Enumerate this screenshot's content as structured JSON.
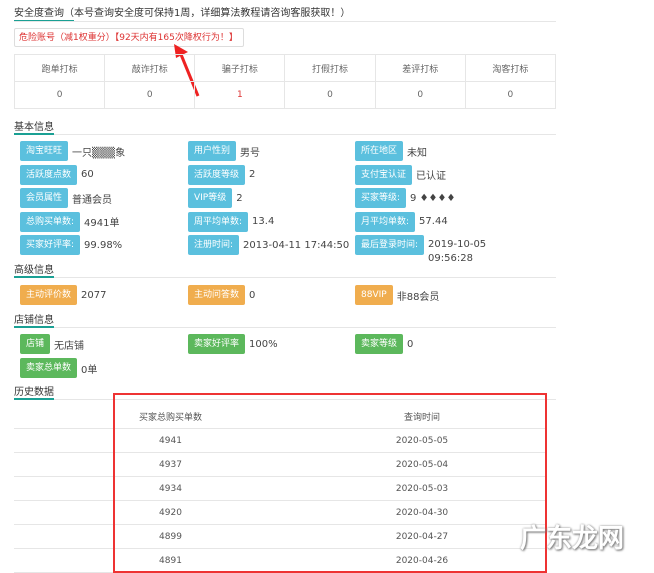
{
  "title": "安全度查询（本号查询安全度可保持1周，详细算法教程请咨询客服获取！）",
  "alert": "危险账号（减1权重分）【92天内有165次降权行为！】",
  "flags": {
    "headers": [
      "跑单打标",
      "敲诈打标",
      "骗子打标",
      "打假打标",
      "差评打标",
      "淘客打标"
    ],
    "values": [
      "0",
      "0",
      "1",
      "0",
      "0",
      "0"
    ]
  },
  "sections": {
    "basic": "基本信息",
    "advanced": "高级信息",
    "shop": "店铺信息",
    "history": "历史数据"
  },
  "basic": [
    {
      "label": "淘宝旺旺",
      "value": "一只▒▒▒象"
    },
    {
      "label": "用户性别",
      "value": "男号"
    },
    {
      "label": "所在地区",
      "value": "未知"
    },
    {
      "label": "活跃度点数",
      "value": "60"
    },
    {
      "label": "活跃度等级",
      "value": "2"
    },
    {
      "label": "支付宝认证",
      "value": "已认证"
    },
    {
      "label": "会员属性",
      "value": "普通会员"
    },
    {
      "label": "VIP等级",
      "value": "2"
    },
    {
      "label": "买家等级:",
      "value": "9 ♦♦♦♦"
    },
    {
      "label": "总购买单数:",
      "value": "4941单"
    },
    {
      "label": "周平均单数:",
      "value": "13.4"
    },
    {
      "label": "月平均单数:",
      "value": "57.44"
    },
    {
      "label": "买家好评率:",
      "value": "99.98%"
    },
    {
      "label": "注册时间:",
      "value": "2013-04-11 17:44:50"
    },
    {
      "label": "最后登录时间:",
      "value": "2019-10-05 09:56:28"
    }
  ],
  "advanced": [
    {
      "label": "主动评价数",
      "value": "2077"
    },
    {
      "label": "主动问答数",
      "value": "0"
    },
    {
      "label": "88VIP",
      "value": "非88会员"
    }
  ],
  "shop": [
    {
      "label": "店铺",
      "value": "无店铺"
    },
    {
      "label": "卖家好评率",
      "value": "100%"
    },
    {
      "label": "卖家等级",
      "value": "0"
    },
    {
      "label": "卖家总单数",
      "value": "0单"
    }
  ],
  "history": {
    "headers": [
      "买家总购买单数",
      "查询时间"
    ],
    "rows": [
      [
        "4941",
        "2020-05-05"
      ],
      [
        "4937",
        "2020-05-04"
      ],
      [
        "4934",
        "2020-05-03"
      ],
      [
        "4920",
        "2020-04-30"
      ],
      [
        "4899",
        "2020-04-27"
      ],
      [
        "4891",
        "2020-04-26"
      ]
    ]
  },
  "watermark": "广东龙网"
}
